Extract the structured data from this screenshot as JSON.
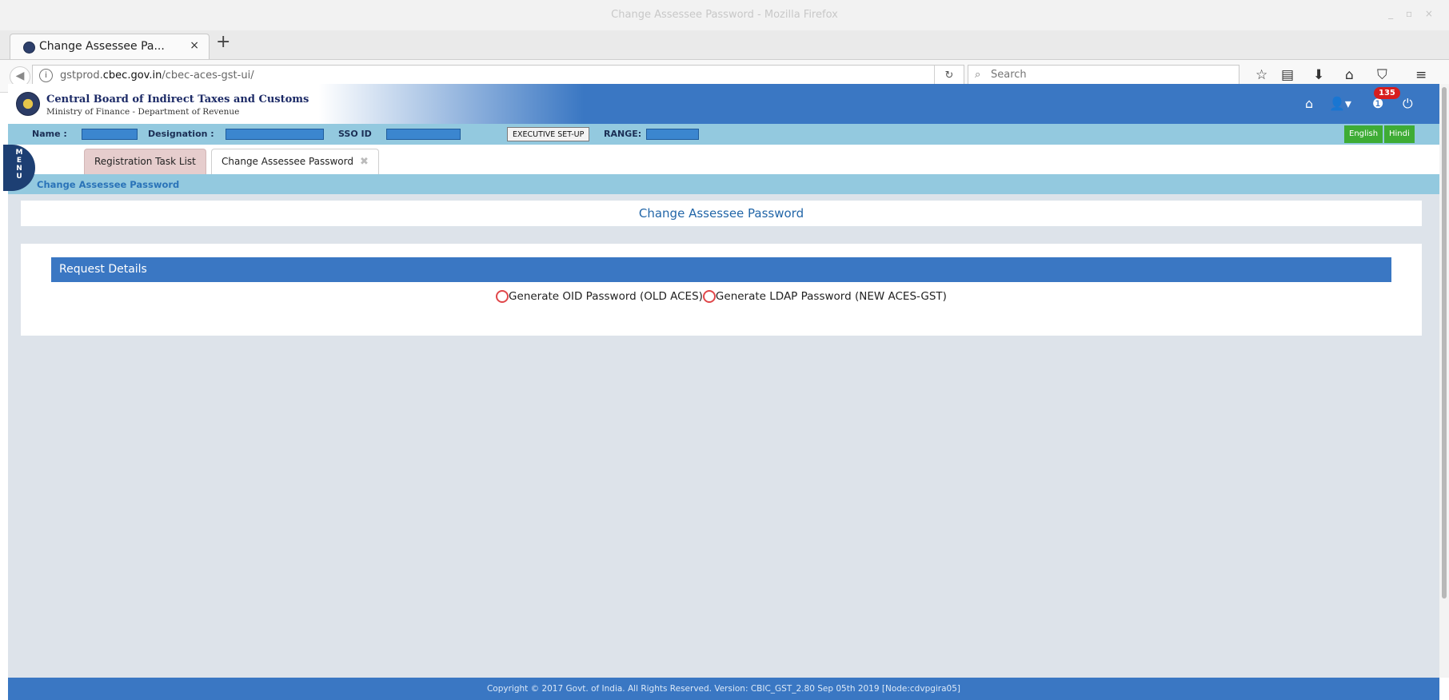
{
  "window": {
    "title": "Change Assessee Password - Mozilla Firefox",
    "controls": "_ ▫ ×"
  },
  "browser": {
    "tab_title": "Change Assessee Pa...",
    "tab_close": "×",
    "new_tab": "+",
    "url_prefix": "gstprod.",
    "url_domain": "cbec.gov.in",
    "url_path": "/cbec-aces-gst-ui/",
    "search_placeholder": "Search",
    "reload_icon": "C"
  },
  "header": {
    "org_name": "Central Board of Indirect Taxes and Customs",
    "org_sub": "Ministry of Finance - Department of Revenue",
    "notification_count": "135"
  },
  "infobar": {
    "name_label": "Name :",
    "designation_label": "Designation :",
    "sso_label": "SSO ID",
    "executive_button": "EXECUTIVE SET-UP",
    "range_label": "RANGE:",
    "lang_english": "English",
    "lang_hindi": "Hindi"
  },
  "menu_label": [
    "M",
    "E",
    "N",
    "U"
  ],
  "app_tabs": [
    {
      "label": "Registration Task List"
    },
    {
      "label": "Change Assessee Password"
    }
  ],
  "breadcrumb": "Change Assessee Password",
  "page_title": "Change Assessee Password",
  "panel": {
    "heading": "Request Details",
    "options": [
      {
        "label": "Generate OID Password (OLD ACES)"
      },
      {
        "label": "Generate LDAP Password (NEW ACES-GST)"
      }
    ]
  },
  "footer": "Copyright © 2017 Govt. of India. All Rights Reserved. Version: CBIC_GST_2.80 Sep 05th 2019     [Node:cdvpgira05]",
  "colors": {
    "primary": "#3a77c3",
    "infobar": "#93c9df",
    "radio": "#e0474a",
    "lang": "#3eac35"
  }
}
